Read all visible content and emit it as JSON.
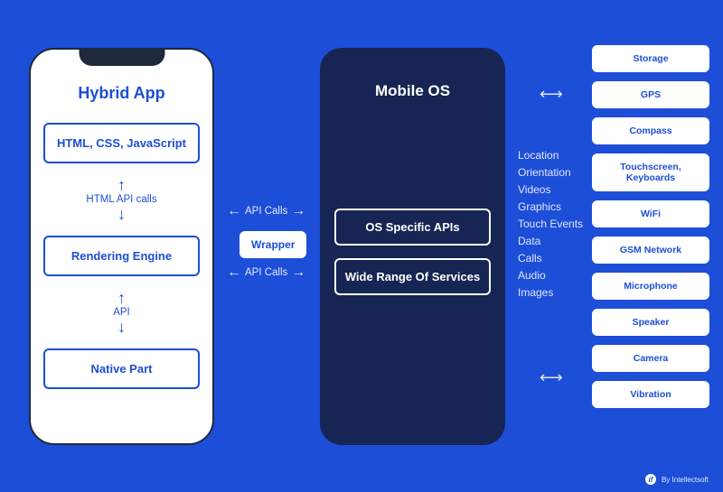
{
  "hybrid": {
    "title": "Hybrid App",
    "box_tech": "HTML, CSS, JavaScript",
    "box_render": "Rendering Engine",
    "box_native": "Native Part",
    "arrow1_label": "HTML API calls",
    "arrow2_label": "API"
  },
  "wrapper": {
    "label": "Wrapper"
  },
  "connectors": {
    "to_wrapper": "API Calls",
    "from_wrapper": "API Calls"
  },
  "mobile_os": {
    "title": "Mobile OS",
    "box_apis": "OS Specific APIs",
    "box_services": "Wide Range Of Services"
  },
  "features": [
    "Location",
    "Orientation",
    "Videos",
    "Graphics",
    "Touch Events",
    "Data",
    "Calls",
    "Audio",
    "Images"
  ],
  "services": [
    "Storage",
    "GPS",
    "Compass",
    "Touchscreen, Keyboards",
    "WiFi",
    "GSM Network",
    "Microphone",
    "Speaker",
    "Camera",
    "Vibration"
  ],
  "credit": "By Intellectsoft",
  "glyphs": {
    "double_h": "⟷",
    "up": "↑",
    "down": "↓",
    "left": "←",
    "right": "→"
  }
}
